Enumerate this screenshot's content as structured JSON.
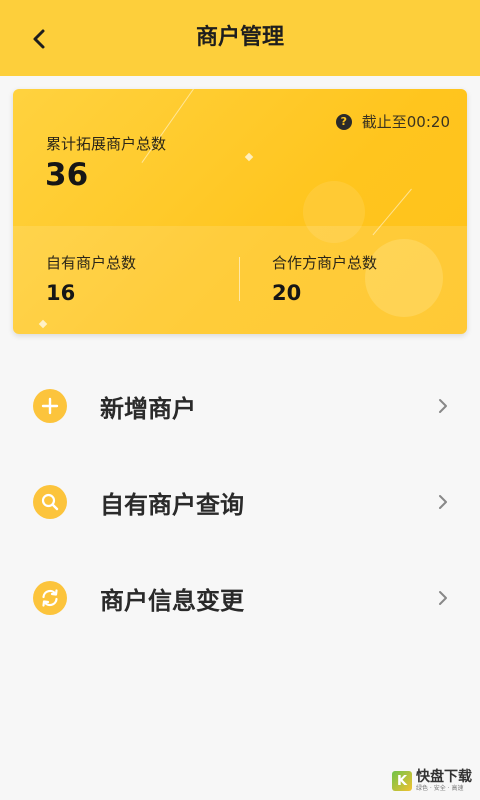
{
  "header": {
    "title": "商户管理",
    "back_icon": "chevron-left-icon",
    "background": "#fdcf3b"
  },
  "summary_card": {
    "cutoff_text": "截止至00:20",
    "help_icon_glyph": "?",
    "total_label": "累计拓展商户总数",
    "total_value": "36",
    "own_label": "自有商户总数",
    "own_value": "16",
    "partner_label": "合作方商户总数",
    "partner_value": "20",
    "accent": "#ffc51e"
  },
  "menu": [
    {
      "label": "新增商户",
      "icon": "plus-circle-icon"
    },
    {
      "label": "自有商户查询",
      "icon": "search-circle-icon"
    },
    {
      "label": "商户信息变更",
      "icon": "refresh-circle-icon"
    }
  ],
  "watermark": {
    "logo_glyph": "K",
    "main": "快盘下载",
    "sub": "绿色 · 安全 · 高速"
  }
}
